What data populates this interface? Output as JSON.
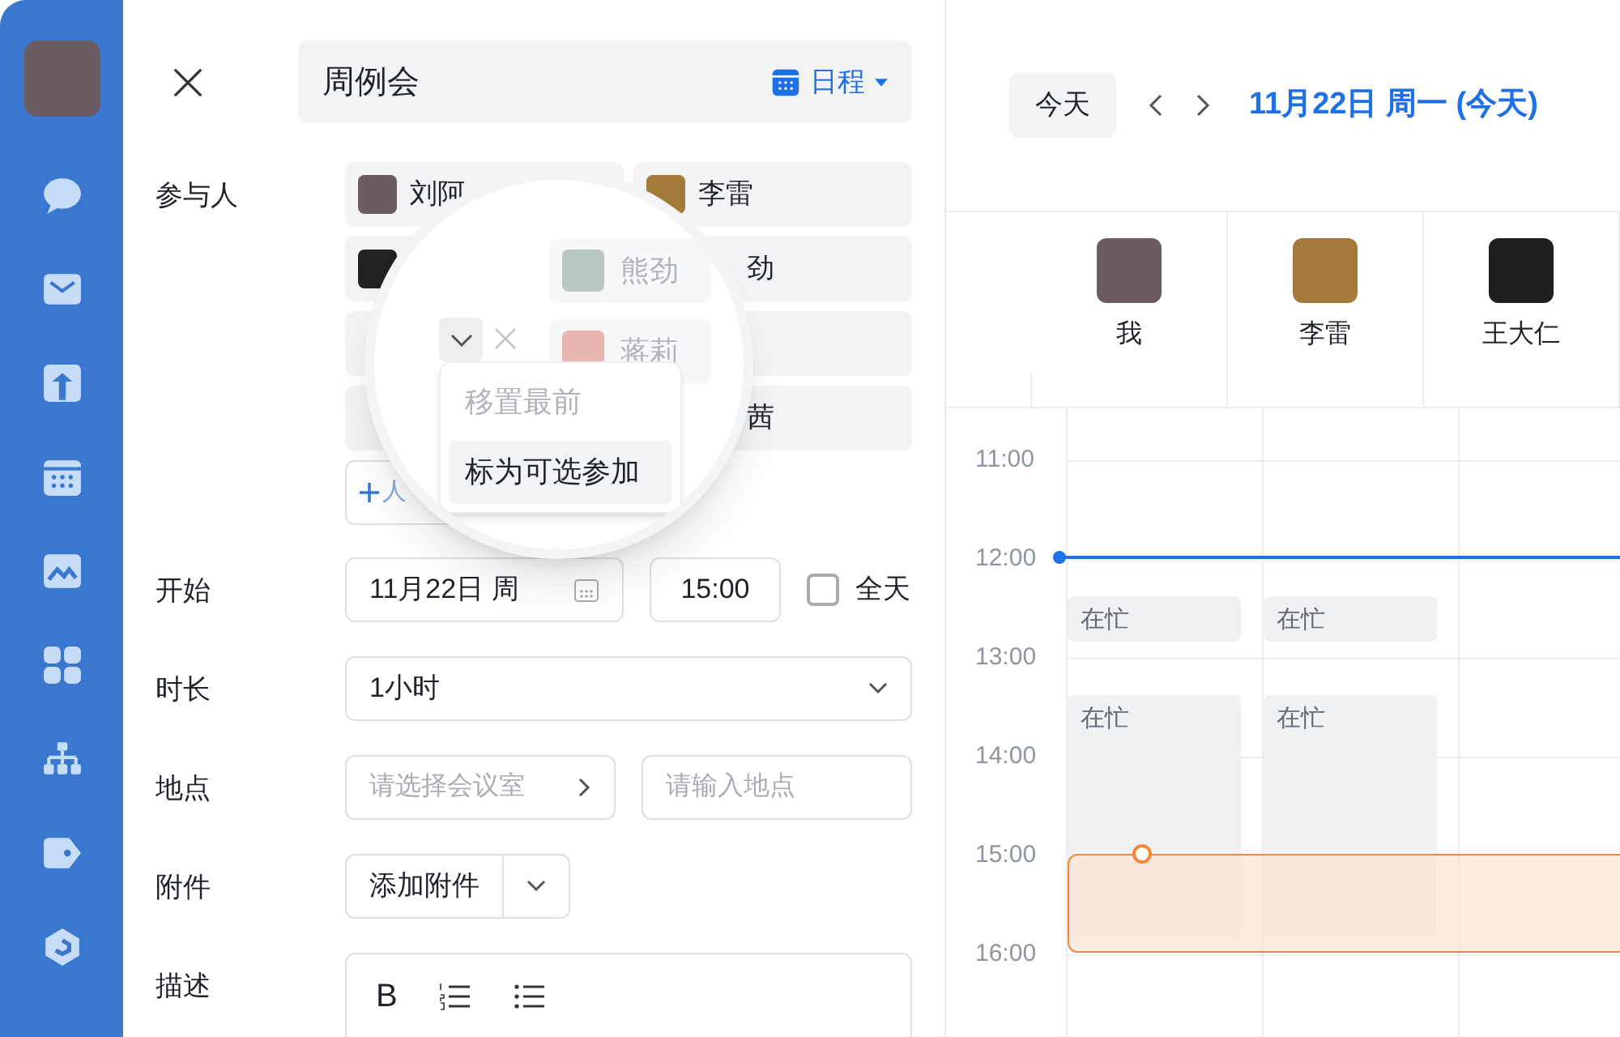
{
  "form": {
    "title": "周例会",
    "type_button": "日程",
    "participants_label": "参与人",
    "participants": [
      {
        "kind": "chip",
        "name": "刘阿",
        "avatar": true
      },
      {
        "kind": "chip",
        "name": "李雷",
        "avatar": true
      },
      {
        "kind": "chip",
        "avatar": true
      },
      {
        "kind": "chip",
        "name": "劲"
      },
      {
        "kind": "chip"
      },
      {
        "kind": "chip"
      },
      {
        "kind": "chip"
      },
      {
        "kind": "chip",
        "name": "茜"
      }
    ],
    "add_button": "人",
    "magnifier": {
      "chips": [
        {
          "name": "熊劲"
        },
        {
          "name": "蒋莉"
        }
      ],
      "menu": [
        {
          "label": "移置最前",
          "disabled": true,
          "selected": false
        },
        {
          "label": "标为可选参加",
          "disabled": false,
          "selected": true
        }
      ]
    },
    "start_label": "开始",
    "start_date": "11月22日 周",
    "start_time": "15:00",
    "all_day": {
      "label": "全天",
      "checked": false
    },
    "duration_label": "时长",
    "duration": "1小时",
    "location_label": "地点",
    "room_placeholder": "请选择会议室",
    "place_placeholder": "请输入地点",
    "attachment_label": "附件",
    "attachment_button": "添加附件",
    "description_label": "描述",
    "toolbar_bold": "B"
  },
  "calendar": {
    "today_button": "今天",
    "date_title": "11月22日 周一 (今天)",
    "people": [
      {
        "name": "我",
        "busy": [
          "在忙",
          "在忙"
        ]
      },
      {
        "name": "李雷",
        "busy": [
          "在忙",
          "在忙"
        ]
      },
      {
        "name": "王大仁"
      }
    ],
    "times": [
      "11:00",
      "12:00",
      "13:00",
      "14:00",
      "15:00",
      "16:00"
    ]
  }
}
